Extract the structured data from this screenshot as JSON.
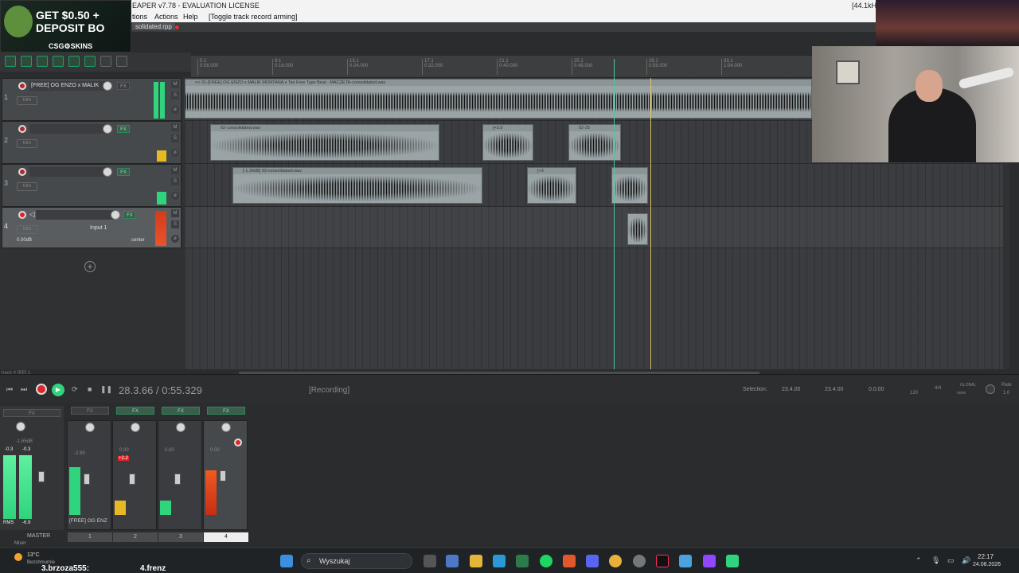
{
  "window": {
    "title": "EAPER v7.78 - EVALUATION LICENSE",
    "samplerate": "[44.1kHz"
  },
  "menu": {
    "options": "tions",
    "actions": "Actions",
    "help": "Help",
    "hint": "[Toggle track record arming]"
  },
  "project_tab": "solidated.rpp",
  "ad": {
    "line1": "GET $0.50 +",
    "line2": "DEPOSIT BO",
    "brand": "CSG⚙SKINS"
  },
  "ruler": [
    {
      "bar": "5.1",
      "time": "0:08.000"
    },
    {
      "bar": "9.1",
      "time": "0:16.000"
    },
    {
      "bar": "13.1",
      "time": "0:24.000"
    },
    {
      "bar": "17.1",
      "time": "0:32.000"
    },
    {
      "bar": "21.1",
      "time": "0:40.000"
    },
    {
      "bar": "25.1",
      "time": "0:48.000"
    },
    {
      "bar": "29.1",
      "time": "0:56.000"
    },
    {
      "bar": "33.1",
      "time": "1:04.000"
    }
  ],
  "tracks": [
    {
      "num": "1",
      "name": "[FREE] OG ENZO x MALIK",
      "trim": "trim",
      "fx": "FX"
    },
    {
      "num": "2",
      "name": "",
      "trim": "trim",
      "fx": "FX"
    },
    {
      "num": "3",
      "name": "",
      "trim": "trim",
      "fx": "FX"
    },
    {
      "num": "4",
      "name": "",
      "trim": "trim",
      "fx": "FX",
      "input": "Input 1",
      "vol": "0.00dB",
      "pan": "center"
    }
  ],
  "items": {
    "t1": "<< 01-[FREE] OG ENZO x MALIK MONTANA x Tax Free Type Beat - MACZETA-consolidated.wav",
    "t2a": "02-consolidated.wav",
    "t2b": "[+3.0",
    "t2c": "02-25",
    "t3a": "[-1.30dB] 03-consolidated.wav",
    "t3b": "[+3",
    "t3c": ""
  },
  "status_left": "track 4 [RE] 1",
  "transport": {
    "position": "28.3.66 / 0:55.329",
    "state": "[Recording]",
    "selection_label": "Selection:",
    "sel_start": "23.4.00",
    "sel_end": "23.4.00",
    "sel_len": "0.0.00",
    "bpm": "120",
    "timesig": "4/4",
    "global": "GLOBAL",
    "global_sub": "none",
    "rate_label": "Rate",
    "rate": "1.0"
  },
  "mixer": {
    "master_label": "MASTER",
    "master_peaks": [
      "-0.3",
      "-0.3"
    ],
    "rms": "RMS",
    "rms_val": "-6.9",
    "master_vol": "-1.65dB",
    "strips": [
      {
        "num": "1",
        "name": "[FREE] OG ENZ",
        "vol": "-2.99",
        "peak": ""
      },
      {
        "num": "2",
        "name": "",
        "vol": "0.00",
        "peak": "+2.2"
      },
      {
        "num": "3",
        "name": "",
        "vol": "0.00",
        "peak": ""
      },
      {
        "num": "4",
        "name": "",
        "vol": "0.00",
        "peak": ""
      }
    ],
    "tab": "Mixer"
  },
  "taskbar": {
    "weather_temp": "13°C",
    "weather_desc": "Bezchmurnie",
    "search": "Wyszukaj",
    "time": "22:17",
    "date": "24.08.2026",
    "ticker": "3.brzoza555:",
    "ticker2": "4.frenz"
  },
  "colors": {
    "accent": "#1e9e6a",
    "record": "#c8282d",
    "playhead": "#4ec9a2",
    "cursor": "#e6c46a"
  }
}
